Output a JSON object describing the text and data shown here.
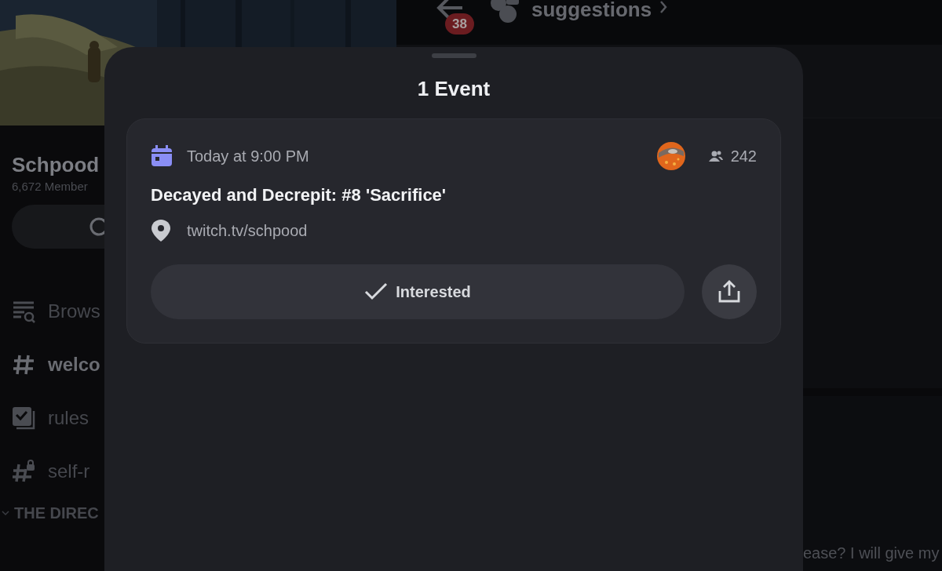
{
  "background": {
    "server_name": "Schpood",
    "member_count": "6,672 Member",
    "channels": [
      {
        "kind": "browse",
        "label": "Brows",
        "unread": false
      },
      {
        "kind": "text",
        "label": "welco",
        "unread": true
      },
      {
        "kind": "rules",
        "label": "rules",
        "unread": false
      },
      {
        "kind": "locked",
        "label": "self-r",
        "unread": false
      }
    ],
    "category": "THE DIREC",
    "header": {
      "unread_count": "38",
      "channel": "suggestions"
    },
    "message_fragment": "ease? I will give my"
  },
  "sheet": {
    "title": "1 Event",
    "events": [
      {
        "time": "Today at 9:00 PM",
        "interested_count": "242",
        "title": "Decayed and Decrepit: #8 'Sacrifice'",
        "location": "twitch.tv/schpood",
        "interested": true,
        "button_label": "Interested"
      }
    ]
  }
}
